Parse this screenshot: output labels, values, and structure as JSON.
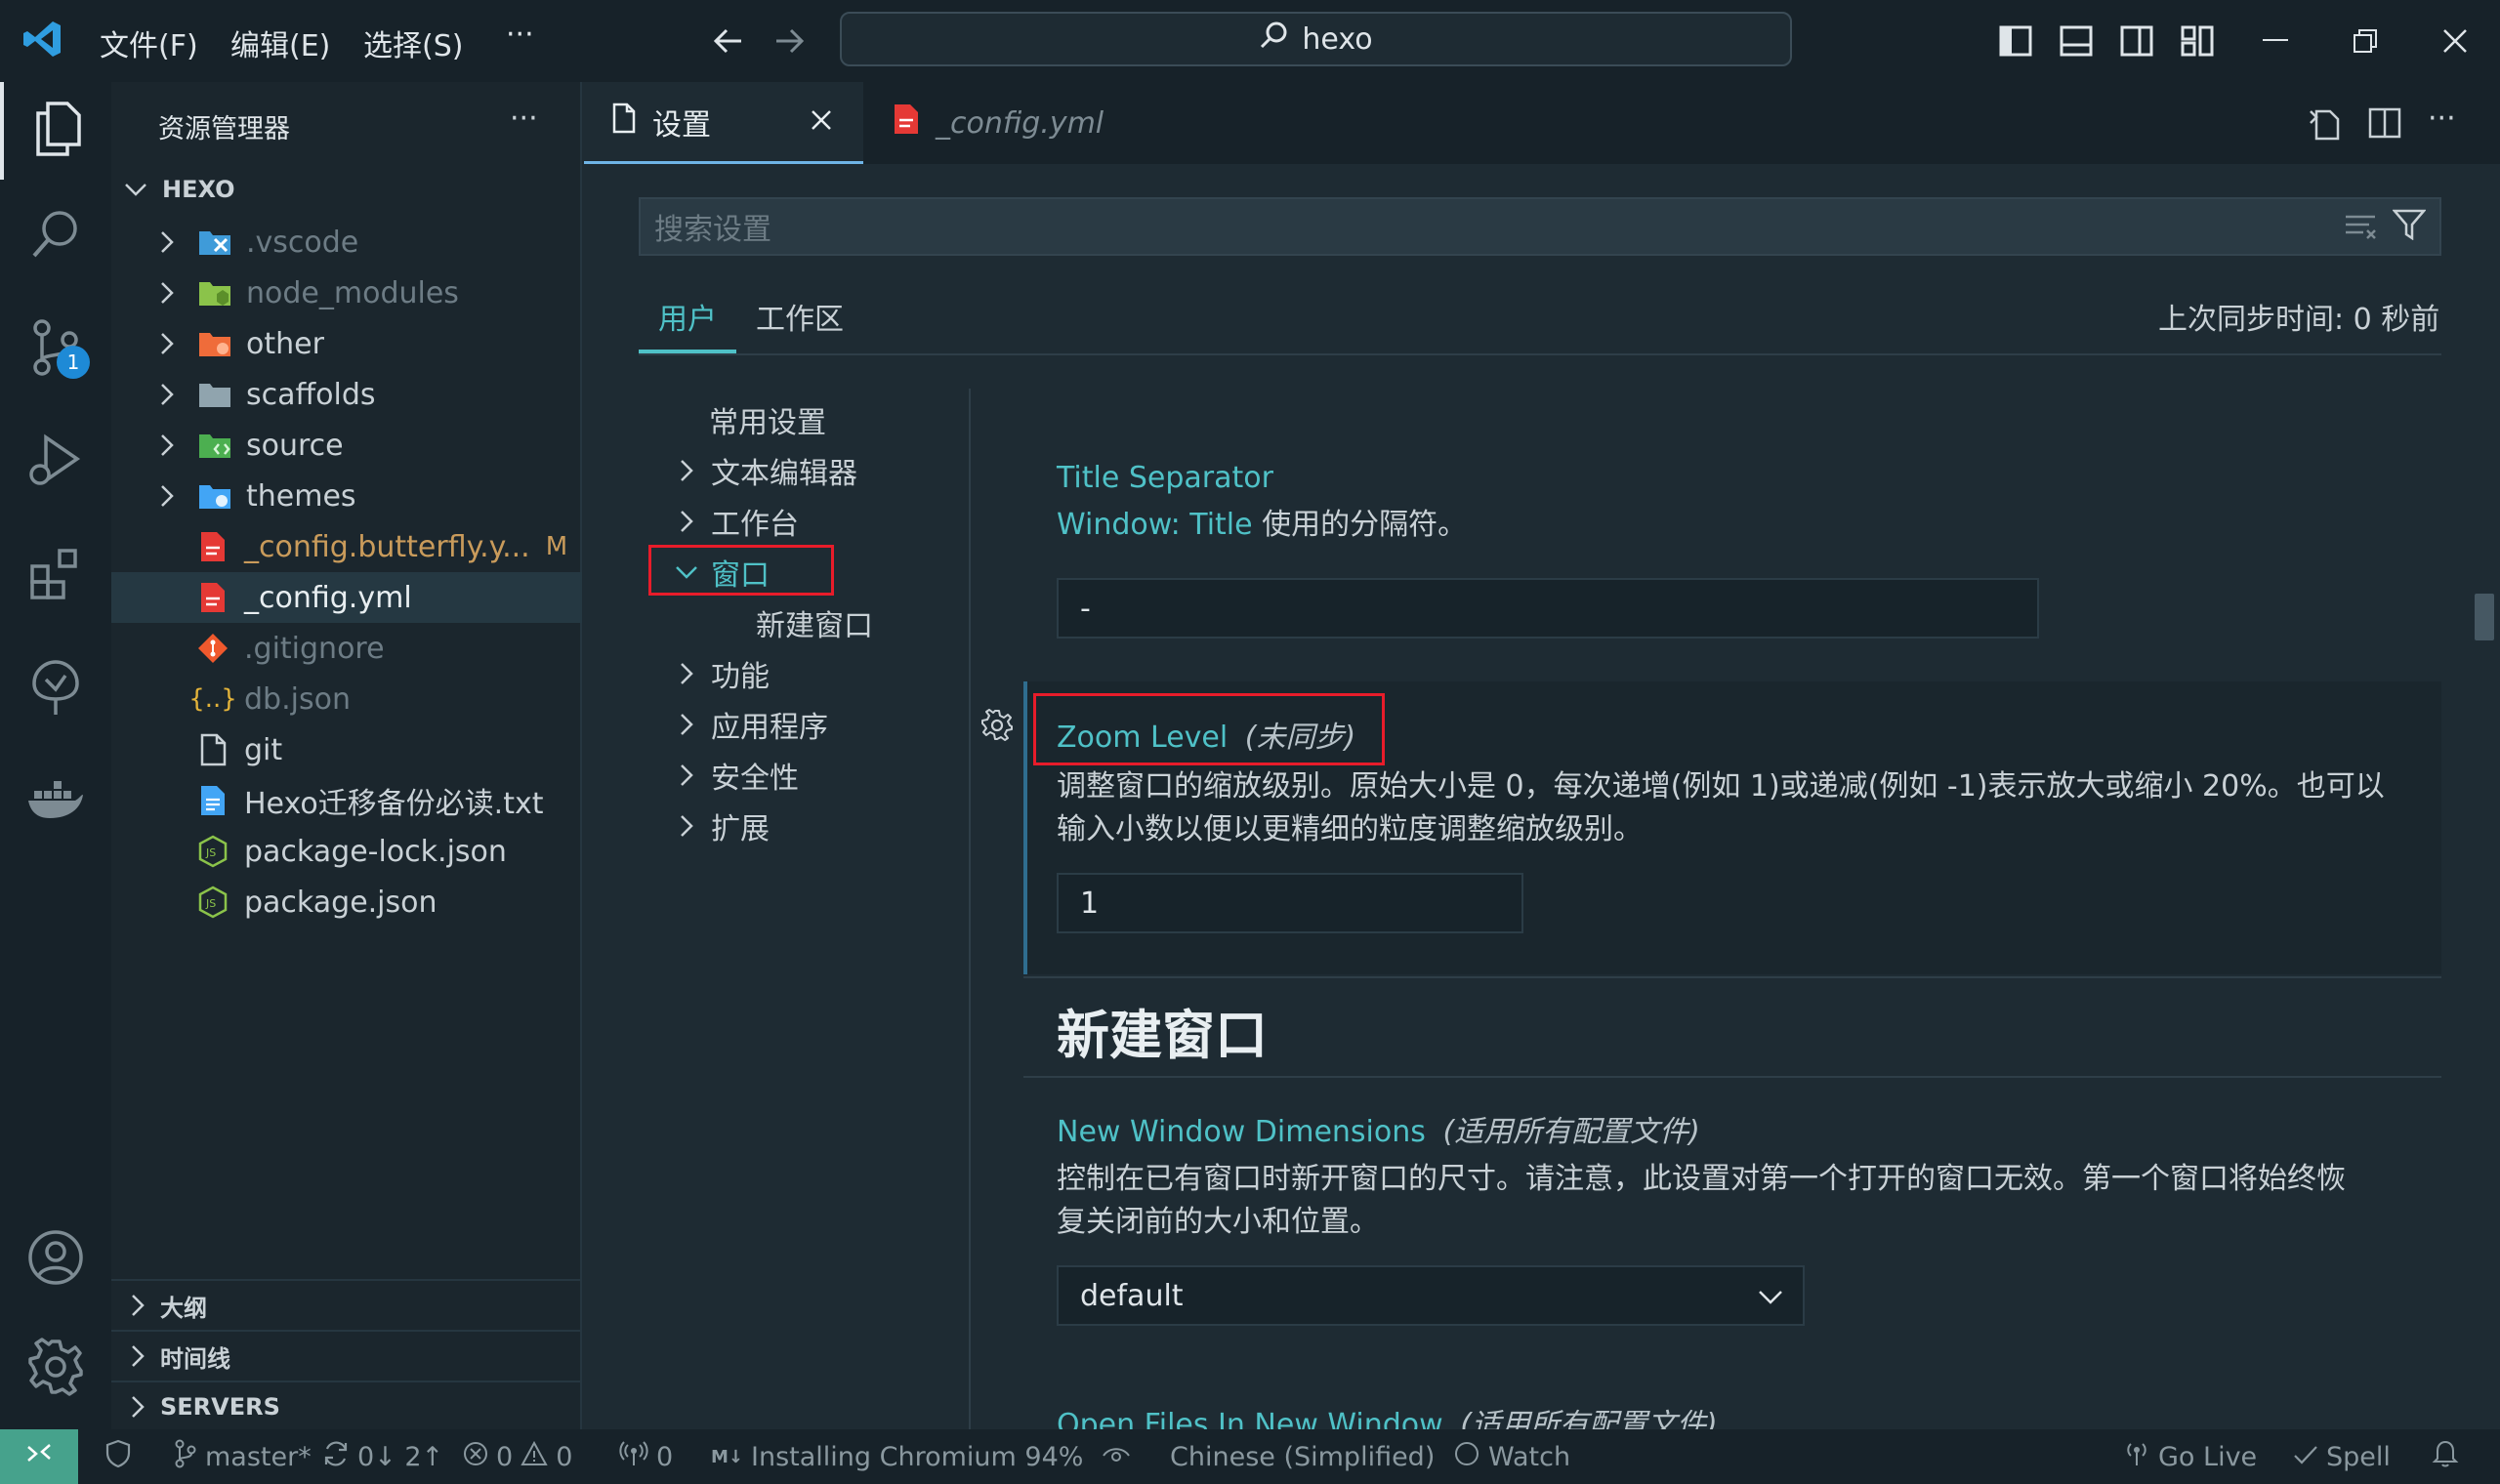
{
  "menu": {
    "file": "文件(F)",
    "edit": "编辑(E)",
    "select": "选择(S)",
    "more": "···"
  },
  "command_center": {
    "text": "hexo"
  },
  "explorer": {
    "title": "资源管理器",
    "more": "···",
    "root": "HEXO",
    "items": [
      {
        "label": ".vscode"
      },
      {
        "label": "node_modules"
      },
      {
        "label": "other"
      },
      {
        "label": "scaffolds"
      },
      {
        "label": "source"
      },
      {
        "label": "themes"
      },
      {
        "label": "_config.butterfly.y...",
        "status": "M"
      },
      {
        "label": "_config.yml"
      },
      {
        "label": ".gitignore"
      },
      {
        "label": "db.json"
      },
      {
        "label": "git"
      },
      {
        "label": "Hexo迁移备份必读.txt"
      },
      {
        "label": "package-lock.json"
      },
      {
        "label": "package.json"
      }
    ],
    "sections": {
      "outline": "大纲",
      "timeline": "时间线",
      "servers": "SERVERS"
    }
  },
  "activity": {
    "scm_badge": "1"
  },
  "tabs": {
    "settings": "设置",
    "config": "_config.yml"
  },
  "settings": {
    "search_placeholder": "搜索设置",
    "scope_user": "用户",
    "scope_workspace": "工作区",
    "sync_status": "上次同步时间: 0 秒前",
    "toc": {
      "common": "常用设置",
      "text_editor": "文本编辑器",
      "workbench": "工作台",
      "window": "窗口",
      "new_window": "新建窗口",
      "features": "功能",
      "application": "应用程序",
      "security": "安全性",
      "extensions": "扩展"
    },
    "title_separator": {
      "title": "Title Separator",
      "desc_link": "Window: Title",
      "desc_rest": " 使用的分隔符。",
      "value": "-"
    },
    "zoom_level": {
      "title": "Zoom Level",
      "scope": "(未同步)",
      "desc_line1": "调整窗口的缩放级别。原始大小是 0，每次递增(例如 1)或递减(例如 -1)表示放大或缩小 20%。也可以",
      "desc_line2": "输入小数以便以更精细的粒度调整缩放级别。",
      "value": "1"
    },
    "group_heading": "新建窗口",
    "new_window_dimensions": {
      "title": "New Window Dimensions",
      "scope": "(适用所有配置文件)",
      "desc_line1": "控制在已有窗口时新开窗口的尺寸。请注意，此设置对第一个打开的窗口无效。第一个窗口将始终恢",
      "desc_line2": "复关闭前的大小和位置。",
      "value": "default"
    },
    "open_files_new_window": {
      "title": "Open Files In New Window",
      "scope": "(适用所有配置文件)"
    }
  },
  "status": {
    "branch": "master*",
    "sync": "0↓ 2↑",
    "errors": "0",
    "warnings": "0",
    "ports": "0",
    "task": "Installing Chromium 94%",
    "language": "Chinese (Simplified)",
    "watch": "Watch",
    "go_live": "Go Live",
    "spell": "Spell"
  },
  "colors": {
    "accent": "#4fc1c7",
    "highlight": "#e81c2a",
    "tab_indicator": "#6fb4e6",
    "remote": "#46a28c"
  }
}
